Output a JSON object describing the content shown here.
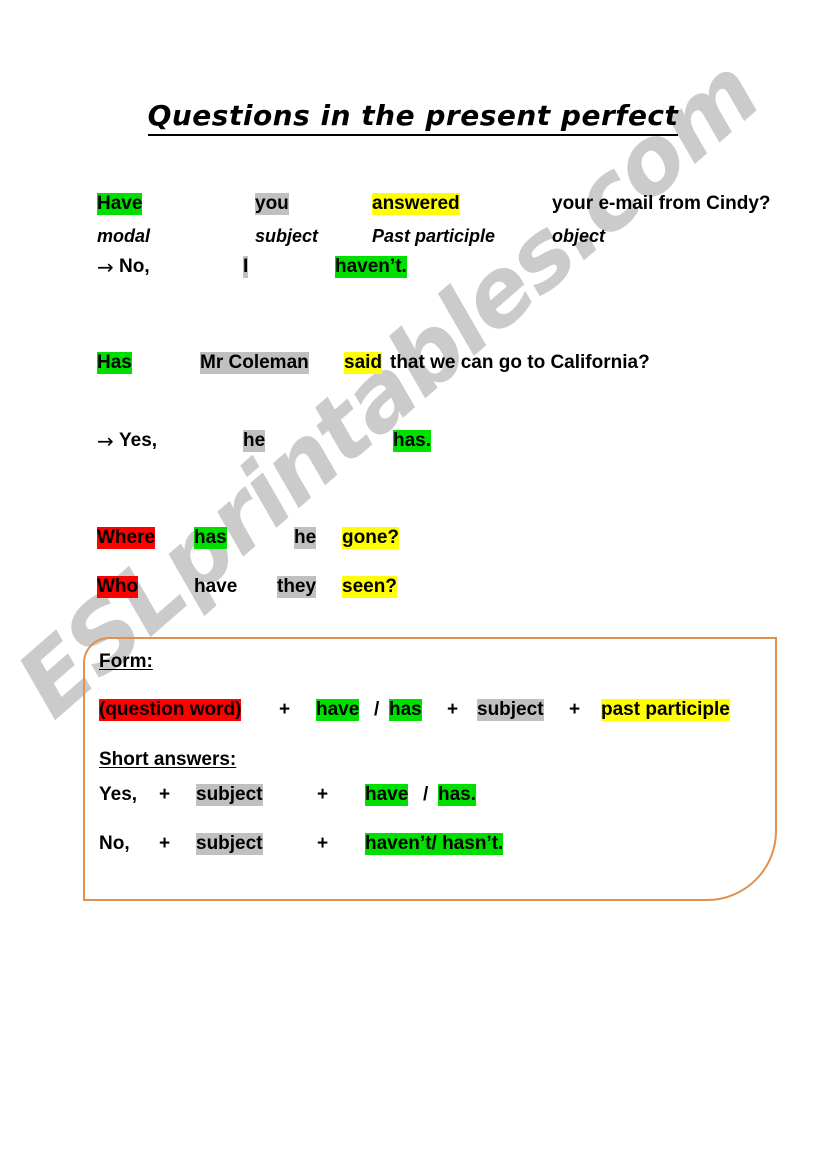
{
  "page": {
    "title": "Questions in the present perfect",
    "watermark": "ESLprintables.com"
  },
  "colors": {
    "green": "#00e000",
    "yellow": "#ffff00",
    "gray": "#c0c0c0",
    "red": "#ff0000",
    "box_border": "#e0914b",
    "text": "#000000",
    "watermark": "#c9c9c9"
  },
  "examples": [
    {
      "question": {
        "modal": "Have",
        "subject": "you",
        "participle": "answered",
        "object": "your e-mail from Cindy?"
      },
      "labels": {
        "modal": "modal",
        "subject": "subject",
        "participle": "Past participle",
        "object": "object"
      },
      "answer": {
        "arrow": "→",
        "polarity": "No,",
        "subject": "I",
        "verb": "haven’t."
      }
    },
    {
      "question": {
        "modal": "Has",
        "subject": "Mr Coleman",
        "participle": "said",
        "object": "that we can go to California?"
      },
      "answer": {
        "arrow": "→",
        "polarity": "Yes,",
        "subject": "he",
        "verb": "has."
      }
    }
  ],
  "wh_questions": [
    {
      "question_word": "Where",
      "auxiliary": "has",
      "subject": "he",
      "participle": "gone?"
    },
    {
      "question_word": "Who",
      "auxiliary": "have",
      "subject": "they",
      "participle": "seen?"
    }
  ],
  "form_box": {
    "form_heading": "Form:",
    "formula": {
      "question_word": "(question word)",
      "plus1": "+",
      "have": "have",
      "slash": "/",
      "has": "has",
      "plus2": "+",
      "subject": "subject",
      "plus3": "+",
      "past_participle": "past participle"
    },
    "short_answers_heading": "Short answers:",
    "short_answers": [
      {
        "polarity": "Yes,",
        "plus1": "+",
        "subject": "subject",
        "plus2": "+",
        "verb_a": "have",
        "slash": "/",
        "verb_b": "has."
      },
      {
        "polarity": "No,",
        "plus1": "+",
        "subject": "subject",
        "plus2": "+",
        "verb_a": "haven’t/ hasn’t.",
        "slash": "",
        "verb_b": ""
      }
    ]
  }
}
